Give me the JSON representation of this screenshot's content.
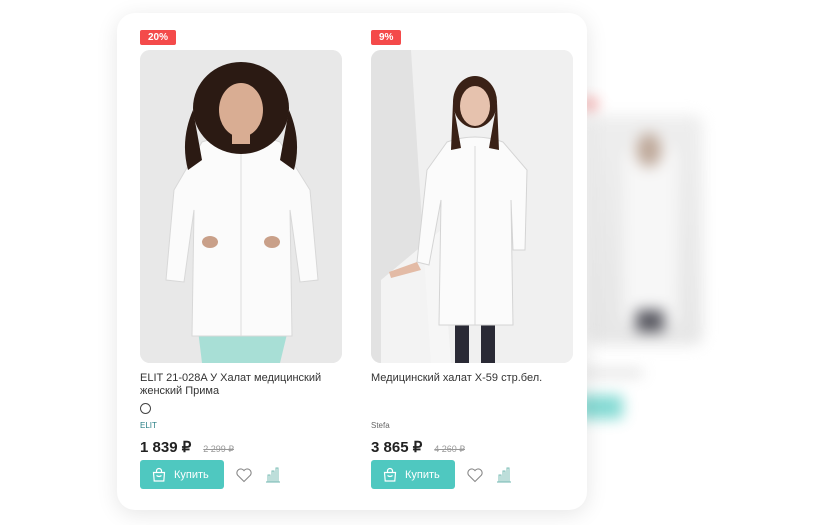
{
  "products": [
    {
      "discount": "20%",
      "title": "ELIT 21-028A У Халат медицинский женский Прима",
      "brand": "ELIT",
      "price": "1 839 ₽",
      "old_price": "2 299 ₽",
      "buy_label": "Купить",
      "has_color_swatch": true
    },
    {
      "discount": "9%",
      "title": "Медицинский халат Х-59 стр.бел.",
      "brand": "Stefa",
      "price": "3 865 ₽",
      "old_price": "4 260 ₽",
      "buy_label": "Купить",
      "has_color_swatch": false
    }
  ],
  "icons": {
    "buy": "shopping-bag-icon",
    "favorite": "heart-icon",
    "compare": "bar-chart-icon"
  },
  "colors": {
    "accent": "#4fc8c0",
    "badge": "#f44a4a"
  }
}
